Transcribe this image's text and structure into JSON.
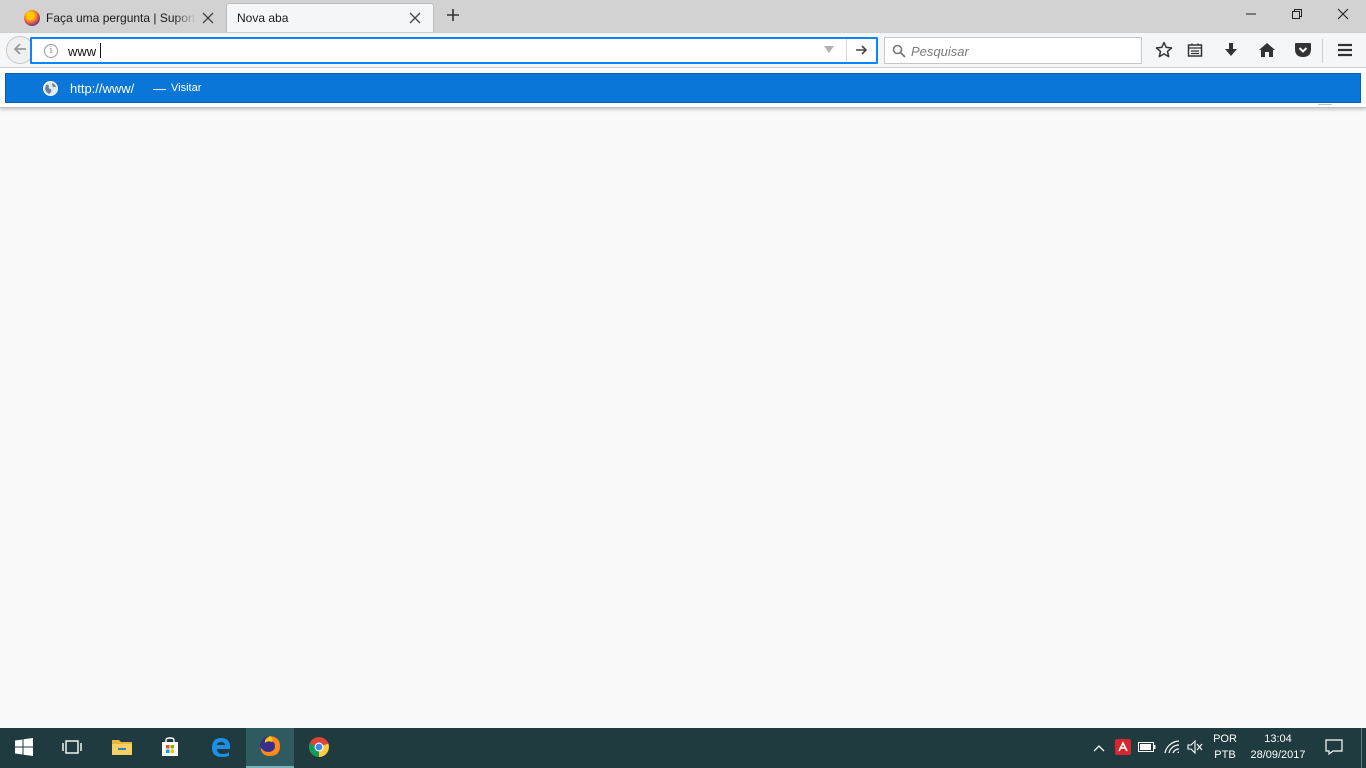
{
  "tabs": [
    {
      "label": "Faça uma pergunta | Suporte",
      "active": false
    },
    {
      "label": "Nova aba",
      "active": true
    }
  ],
  "urlbar": {
    "value": "www"
  },
  "search": {
    "placeholder": "Pesquisar"
  },
  "autocomplete": {
    "url": "http://www/",
    "separator": "—",
    "action": "Visitar"
  },
  "taskbar": {
    "language": "POR",
    "layout": "PTB",
    "time": "13:04",
    "date": "28/09/2017"
  },
  "colors": {
    "accent": "#0a76d8",
    "taskbar": "#1f3b40",
    "tabstrip": "#d2d2d2"
  },
  "icons": [
    "firefox-icon",
    "close-icon",
    "plus-icon",
    "minimize-icon",
    "restore-icon",
    "back-arrow-icon",
    "info-icon",
    "dropdown-arrow-icon",
    "go-arrow-icon",
    "search-icon",
    "bookmark-star-icon",
    "library-icon",
    "download-icon",
    "home-icon",
    "pocket-icon",
    "hamburger-menu-icon",
    "globe-icon",
    "windows-start-icon",
    "task-view-icon",
    "file-explorer-icon",
    "store-icon",
    "edge-icon",
    "chrome-icon",
    "chevron-up-icon",
    "antivirus-icon",
    "battery-icon",
    "wifi-icon",
    "volume-muted-icon",
    "action-center-icon"
  ]
}
